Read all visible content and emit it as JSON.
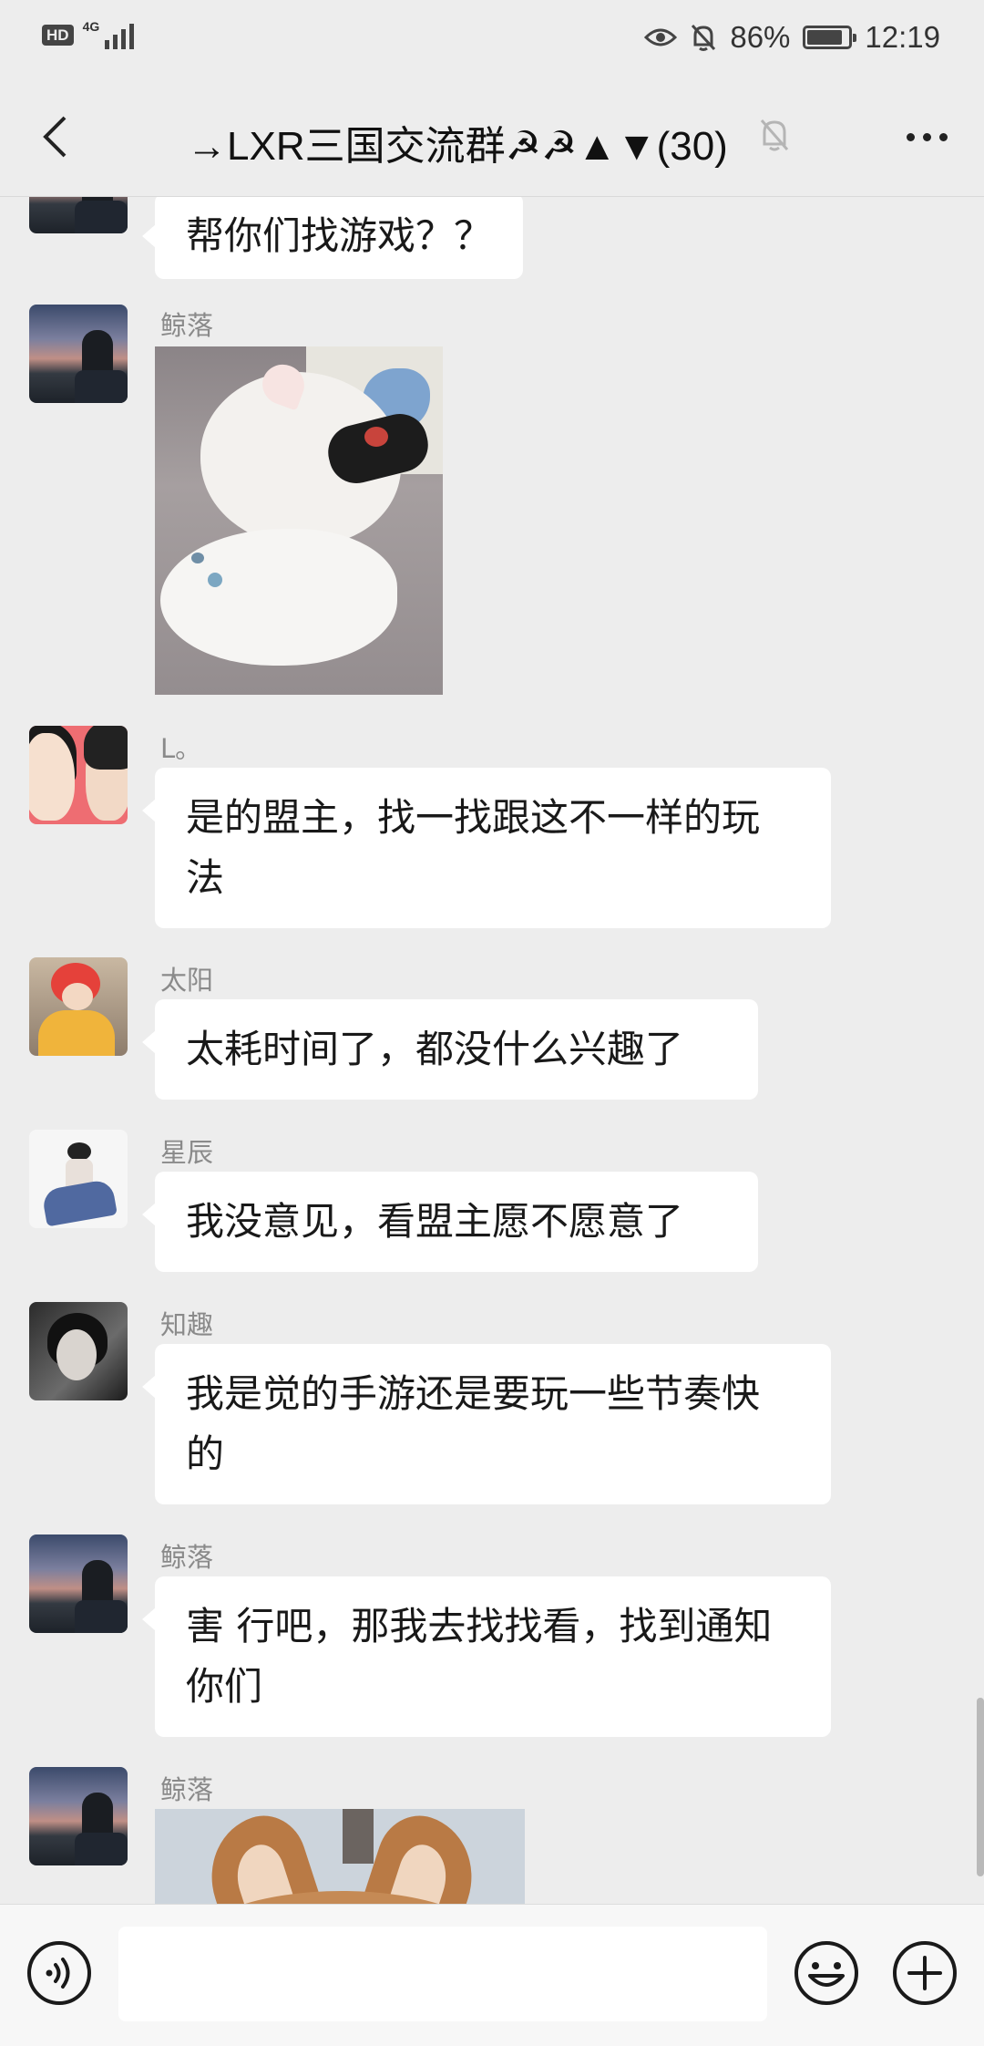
{
  "status_bar": {
    "hd": "HD",
    "network": "4G",
    "battery_percent": "86%",
    "battery_level": 0.86,
    "time": "12:19"
  },
  "nav": {
    "title": "→LXR三国交流群☭☭▲▼(30)",
    "back_icon": "chevron-left-icon",
    "mute_icon": "bell-muted-icon",
    "more_icon": "more-dots-icon"
  },
  "messages": [
    {
      "sender": "",
      "text": "帮你们找游戏？？"
    },
    {
      "sender": "鲸落",
      "image": "cats-photo"
    },
    {
      "sender": "L。",
      "text_lines": [
        "是的盟主，找一找跟这不一样的玩",
        "法"
      ]
    },
    {
      "sender": "太阳",
      "text": "太耗时间了，都没什么兴趣了"
    },
    {
      "sender": "星辰",
      "text": "我没意见，看盟主愿不愿意了"
    },
    {
      "sender": "知趣",
      "text_lines": [
        "我是觉的手游还是要玩一些节奏快",
        "的"
      ]
    },
    {
      "sender": "鲸落",
      "text_lines": [
        "害 行吧，那我去找找看，找到通知",
        "你们"
      ]
    },
    {
      "sender": "鲸落",
      "image": "dog-photo"
    }
  ],
  "input_bar": {
    "voice_icon": "voice-icon",
    "text_value": "",
    "emoji_icon": "emoji-icon",
    "plus_icon": "plus-icon"
  },
  "colors": {
    "background": "#ededed",
    "bubble": "#ffffff",
    "sender_name": "#8a8a8a"
  }
}
